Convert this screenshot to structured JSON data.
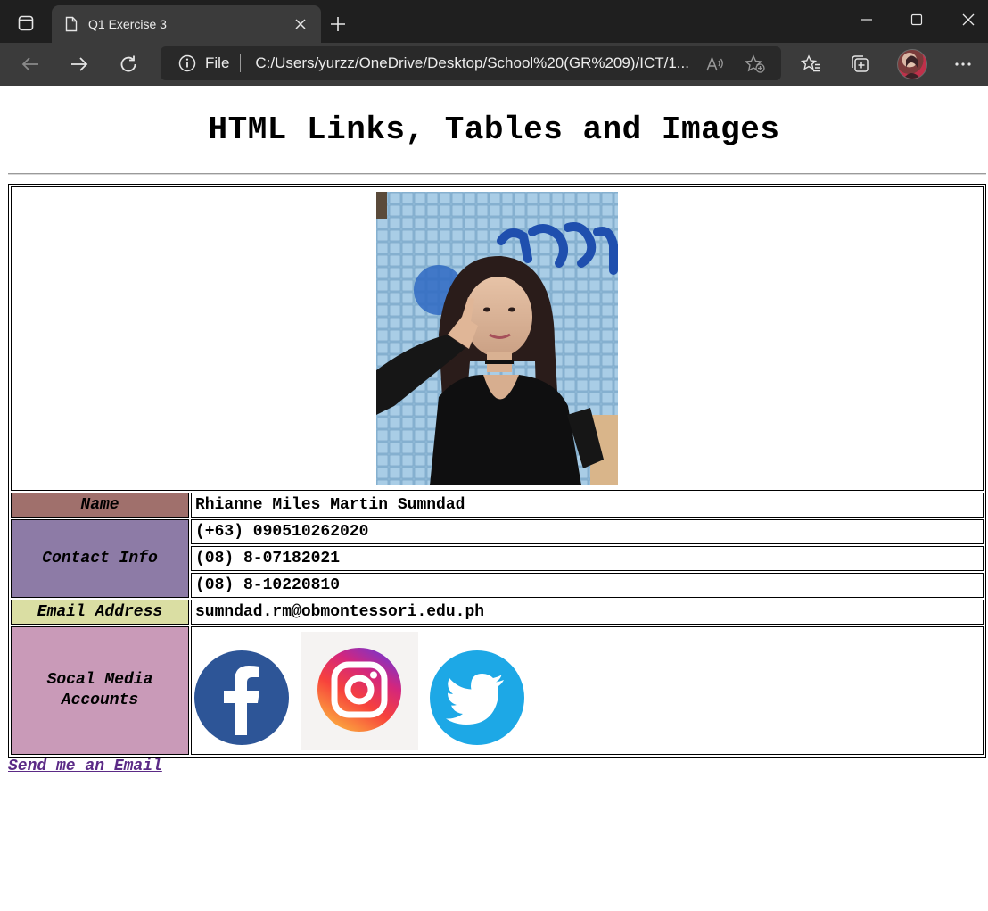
{
  "browser": {
    "tab_title": "Q1 Exercise 3",
    "address_scheme": "File",
    "address_url": "C:/Users/yurzz/OneDrive/Desktop/School%20(GR%209)/ICT/1..."
  },
  "page": {
    "heading": "HTML Links, Tables and Images",
    "name_label": "Name",
    "name_value": "Rhianne Miles Martin Sumndad",
    "contact_label": "Contact Info",
    "contacts": [
      "(+63) 090510262020",
      "(08) 8-07182021",
      "(08) 8-10220810"
    ],
    "email_label": "Email Address",
    "email_value": "sumndad.rm@obmontessori.edu.ph",
    "social_label": "Socal Media Accounts",
    "social_icons": [
      "facebook-icon",
      "instagram-icon",
      "twitter-icon"
    ],
    "send_link": "Send me an Email"
  },
  "colors": {
    "name_bg": "#a0706c",
    "contact_bg": "#8d7ba6",
    "email_bg": "#dadea3",
    "social_bg": "#c99ab8",
    "facebook": "#2d5597",
    "twitter": "#1da8e6",
    "link": "#5b2a86"
  }
}
